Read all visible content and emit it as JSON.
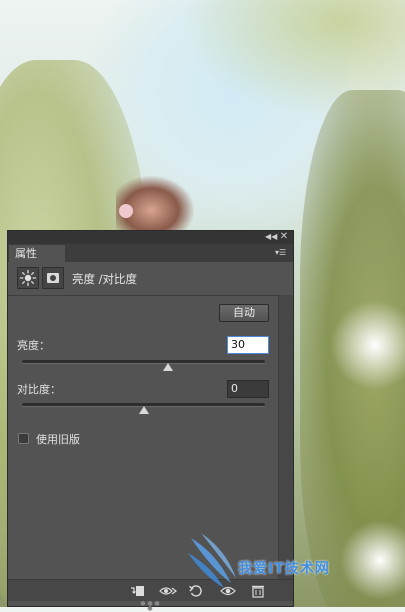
{
  "panel": {
    "tab_label": "属性",
    "header_title": "亮度 /对比度",
    "auto_button": "自动",
    "brightness": {
      "label": "亮度：",
      "value": "30",
      "slider_fraction": 0.6
    },
    "contrast": {
      "label": "对比度：",
      "value": "0",
      "slider_fraction": 0.5
    },
    "legacy_checkbox": {
      "label": "使用旧版",
      "checked": false
    }
  },
  "watermark": {
    "text": "我爱IT技术网"
  },
  "icons": {
    "titlebar": [
      "collapse-arrows-icon",
      "close-icon"
    ],
    "tab": [
      "panel-menu-icon"
    ],
    "header": [
      "brightness-contrast-adjustment-icon",
      "layer-mask-icon"
    ],
    "bottom": [
      "clip-to-layer-icon",
      "view-previous-state-icon",
      "reset-icon",
      "visibility-eye-icon",
      "trash-icon"
    ]
  },
  "colors": {
    "panel_bg": "#535353",
    "input_focus_border": "#4a8ad8",
    "watermark_blue": "#3f8ee0"
  }
}
